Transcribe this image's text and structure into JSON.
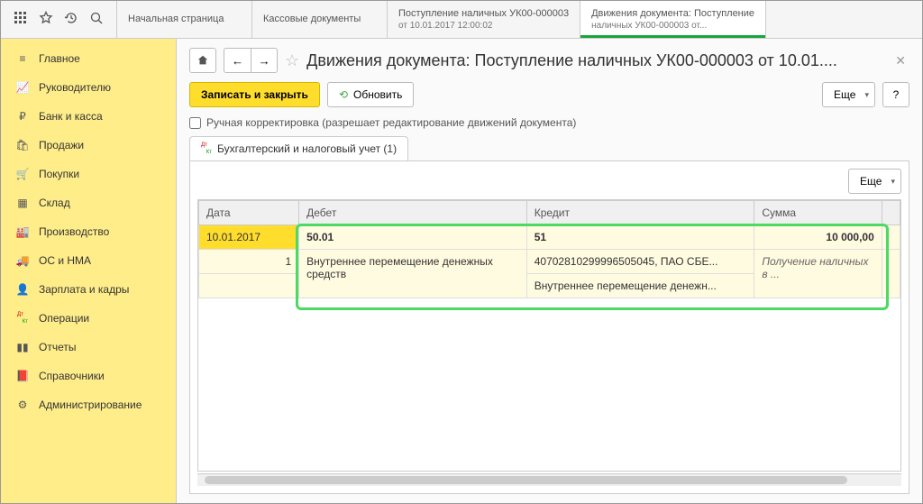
{
  "top_tabs": [
    {
      "line1": "Начальная страница",
      "line2": ""
    },
    {
      "line1": "Кассовые документы",
      "line2": ""
    },
    {
      "line1": "Поступление наличных УК00-000003",
      "line2": "от 10.01.2017 12:00:02"
    },
    {
      "line1": "Движения документа: Поступление",
      "line2": "наличных УК00-000003 от..."
    }
  ],
  "sidebar": {
    "items": [
      {
        "label": "Главное"
      },
      {
        "label": "Руководителю"
      },
      {
        "label": "Банк и касса"
      },
      {
        "label": "Продажи"
      },
      {
        "label": "Покупки"
      },
      {
        "label": "Склад"
      },
      {
        "label": "Производство"
      },
      {
        "label": "ОС и НМА"
      },
      {
        "label": "Зарплата и кадры"
      },
      {
        "label": "Операции"
      },
      {
        "label": "Отчеты"
      },
      {
        "label": "Справочники"
      },
      {
        "label": "Администрирование"
      }
    ]
  },
  "header": {
    "title": "Движения документа: Поступление наличных УК00-000003 от 10.01...."
  },
  "toolbar": {
    "save_close": "Записать и закрыть",
    "refresh": "Обновить",
    "more": "Еще",
    "help": "?"
  },
  "checkbox": {
    "label": "Ручная корректировка (разрешает редактирование движений документа)"
  },
  "doc_tab": {
    "label": "Бухгалтерский и налоговый учет (1)"
  },
  "table": {
    "more": "Еще",
    "headers": {
      "date": "Дата",
      "debit": "Дебет",
      "credit": "Кредит",
      "sum": "Сумма"
    },
    "row1": {
      "date": "10.01.2017",
      "debit": "50.01",
      "credit": "51",
      "sum": "10 000,00"
    },
    "row2": {
      "num": "1",
      "debit": "Внутреннее перемещение денежных средств",
      "credit": "40702810299996505045, ПАО СБЕ...",
      "sum": "Получение наличных в ..."
    },
    "row3": {
      "credit": "Внутреннее перемещение денежн..."
    }
  }
}
